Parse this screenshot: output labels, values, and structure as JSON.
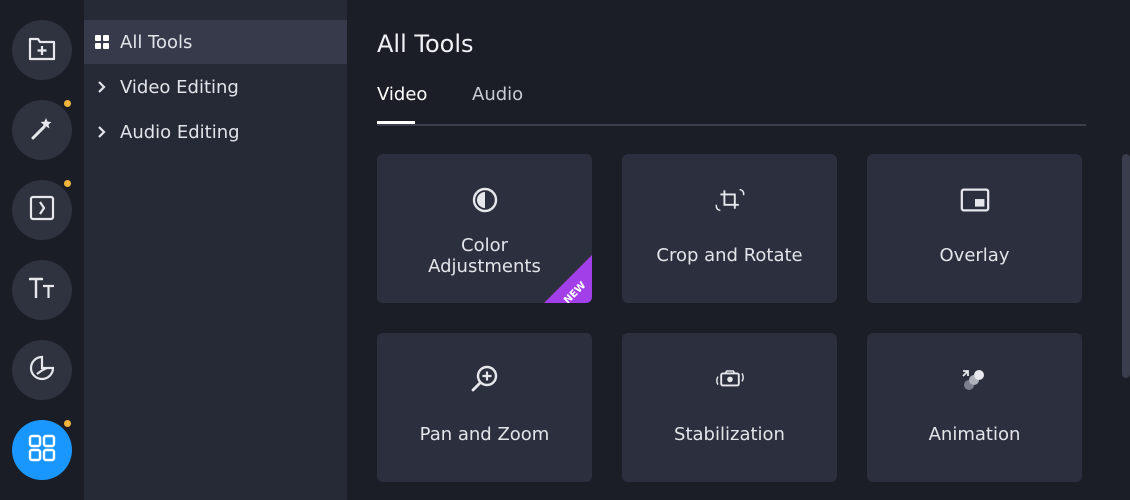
{
  "rail": {
    "items": [
      {
        "icon": "add-folder-icon",
        "dot": false
      },
      {
        "icon": "magic-wand-icon",
        "dot": true
      },
      {
        "icon": "transitions-icon",
        "dot": true
      },
      {
        "icon": "titles-icon",
        "dot": false
      },
      {
        "icon": "stickers-icon",
        "dot": false
      },
      {
        "icon": "all-tools-grid-icon",
        "dot": true,
        "active": true
      }
    ],
    "accent_color": "#1a97ff",
    "dot_color": "#f2b63c"
  },
  "tree": {
    "items": [
      {
        "label": "All Tools",
        "icon": "grid-icon",
        "selected": true
      },
      {
        "label": "Video Editing",
        "icon": "chevron-right-icon"
      },
      {
        "label": "Audio Editing",
        "icon": "chevron-right-icon"
      }
    ]
  },
  "main": {
    "title": "All Tools",
    "tabs": [
      {
        "label": "Video",
        "active": true
      },
      {
        "label": "Audio",
        "active": false
      }
    ],
    "cards": [
      {
        "label_line1": "Color",
        "label_line2": "Adjustments",
        "icon": "color-adjust-icon",
        "badge": "NEW"
      },
      {
        "label": "Crop and Rotate",
        "icon": "crop-rotate-icon"
      },
      {
        "label": "Overlay",
        "icon": "overlay-icon"
      },
      {
        "label": "Pan and Zoom",
        "icon": "zoom-in-icon"
      },
      {
        "label": "Stabilization",
        "icon": "stabilization-icon"
      },
      {
        "label": "Animation",
        "icon": "animation-icon"
      }
    ],
    "badge_color": "#a23fe8"
  }
}
